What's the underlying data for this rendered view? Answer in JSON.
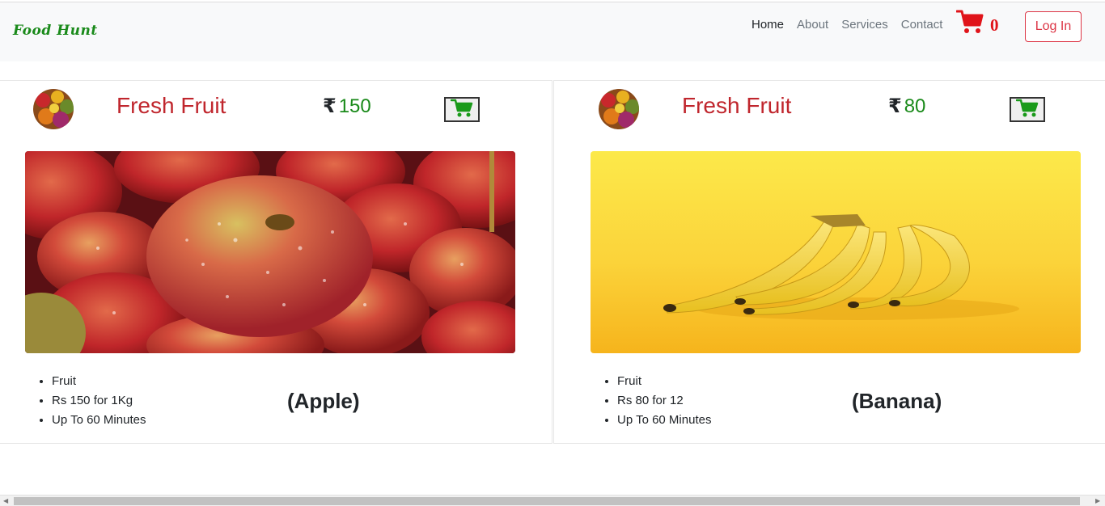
{
  "nav": {
    "brand": "Food Hunt",
    "links": [
      "Home",
      "About",
      "Services",
      "Contact"
    ],
    "cart_count": "0",
    "login_label": "Log In"
  },
  "products": [
    {
      "title": "Fresh Fruit",
      "currency": "₹",
      "price": "150",
      "details": [
        "Fruit",
        "Rs 150 for 1Kg",
        "Up To 60 Minutes"
      ],
      "variety": "(Apple)"
    },
    {
      "title": "Fresh Fruit",
      "currency": "₹",
      "price": "80",
      "details": [
        "Fruit",
        "Rs 80 for 12",
        "Up To 60 Minutes"
      ],
      "variety": "(Banana)"
    }
  ],
  "icons": {
    "nav_cart": "cart-icon",
    "add_to_cart": "cart-icon"
  },
  "colors": {
    "brand": "#1a8a1a",
    "title": "#c0262d",
    "price": "#1a8a1a",
    "cart_nav": "#e0141a",
    "login": "#dc3545"
  }
}
